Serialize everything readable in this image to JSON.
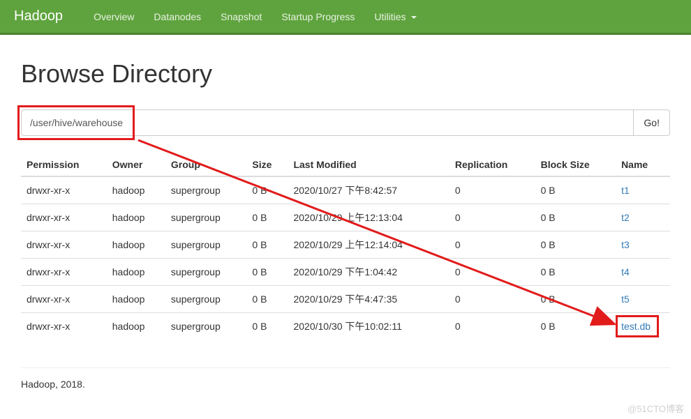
{
  "nav": {
    "brand": "Hadoop",
    "items": [
      "Overview",
      "Datanodes",
      "Snapshot",
      "Startup Progress",
      "Utilities"
    ]
  },
  "page": {
    "title": "Browse Directory"
  },
  "path": {
    "value": "/user/hive/warehouse",
    "go_label": "Go!"
  },
  "table": {
    "headers": {
      "permission": "Permission",
      "owner": "Owner",
      "group": "Group",
      "size": "Size",
      "last_modified": "Last Modified",
      "replication": "Replication",
      "block_size": "Block Size",
      "name": "Name"
    },
    "rows": [
      {
        "permission": "drwxr-xr-x",
        "owner": "hadoop",
        "group": "supergroup",
        "size": "0 B",
        "last_modified": "2020/10/27 下午8:42:57",
        "replication": "0",
        "block_size": "0 B",
        "name": "t1"
      },
      {
        "permission": "drwxr-xr-x",
        "owner": "hadoop",
        "group": "supergroup",
        "size": "0 B",
        "last_modified": "2020/10/29 上午12:13:04",
        "replication": "0",
        "block_size": "0 B",
        "name": "t2"
      },
      {
        "permission": "drwxr-xr-x",
        "owner": "hadoop",
        "group": "supergroup",
        "size": "0 B",
        "last_modified": "2020/10/29 上午12:14:04",
        "replication": "0",
        "block_size": "0 B",
        "name": "t3"
      },
      {
        "permission": "drwxr-xr-x",
        "owner": "hadoop",
        "group": "supergroup",
        "size": "0 B",
        "last_modified": "2020/10/29 下午1:04:42",
        "replication": "0",
        "block_size": "0 B",
        "name": "t4"
      },
      {
        "permission": "drwxr-xr-x",
        "owner": "hadoop",
        "group": "supergroup",
        "size": "0 B",
        "last_modified": "2020/10/29 下午4:47:35",
        "replication": "0",
        "block_size": "0 B",
        "name": "t5"
      },
      {
        "permission": "drwxr-xr-x",
        "owner": "hadoop",
        "group": "supergroup",
        "size": "0 B",
        "last_modified": "2020/10/30 下午10:02:11",
        "replication": "0",
        "block_size": "0 B",
        "name": "test.db"
      }
    ]
  },
  "footer": {
    "text": "Hadoop, 2018."
  },
  "watermark": "@51CTO博客"
}
